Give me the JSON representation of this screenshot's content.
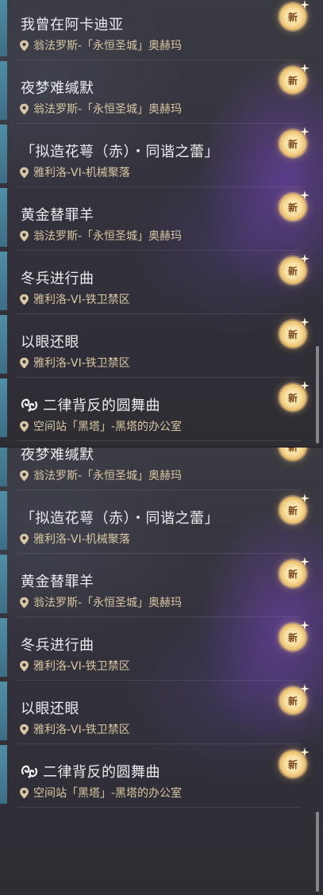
{
  "panels": [
    {
      "missions": [
        {
          "title": "我曾在阿卡迪亚",
          "location": "翁法罗斯-「永恒圣城」奥赫玛",
          "badge": "新"
        },
        {
          "title": "夜梦难缄默",
          "location": "翁法罗斯-「永恒圣城」奥赫玛",
          "badge": "新"
        },
        {
          "title": "「拟造花萼（赤）・同谐之蕾」",
          "location": "雅利洛-VI-机械聚落",
          "badge": "新"
        },
        {
          "title": "黄金替罪羊",
          "location": "翁法罗斯-「永恒圣城」奥赫玛",
          "badge": "新"
        },
        {
          "title": "冬兵进行曲",
          "location": "雅利洛-VI-铁卫禁区",
          "badge": "新"
        },
        {
          "title": "以眼还眼",
          "location": "雅利洛-VI-铁卫禁区",
          "badge": "新"
        },
        {
          "title": "二律背反的圆舞曲",
          "location": "空间站「黑塔」-黑塔的办公室",
          "badge": "新",
          "icon": "quest-type-icon"
        }
      ]
    },
    {
      "missions": [
        {
          "title": "夜梦难缄默",
          "location": "翁法罗斯-「永恒圣城」奥赫玛",
          "badge": "新"
        },
        {
          "title": "「拟造花萼（赤）・同谐之蕾」",
          "location": "雅利洛-VI-机械聚落",
          "badge": "新"
        },
        {
          "title": "黄金替罪羊",
          "location": "翁法罗斯-「永恒圣城」奥赫玛",
          "badge": "新"
        },
        {
          "title": "冬兵进行曲",
          "location": "雅利洛-VI-铁卫禁区",
          "badge": "新"
        },
        {
          "title": "以眼还眼",
          "location": "雅利洛-VI-铁卫禁区",
          "badge": "新"
        },
        {
          "title": "二律背反的圆舞曲",
          "location": "空间站「黑塔」-黑塔的办公室",
          "badge": "新",
          "icon": "quest-type-icon"
        }
      ]
    }
  ],
  "colors": {
    "title": "#ecebf0",
    "location": "#d9c7a3",
    "edge_accent": "#4f8fa6",
    "badge_gold": "#f7dd9c"
  },
  "icons": {
    "location": "map-pin-icon",
    "badge": "new-badge-icon",
    "quest": "quest-type-icon"
  }
}
